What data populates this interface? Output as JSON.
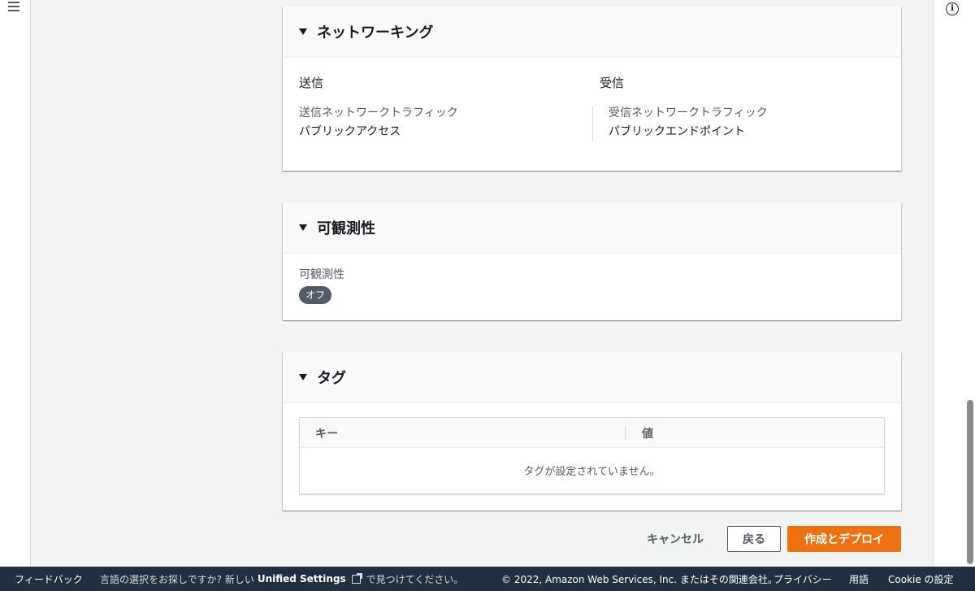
{
  "networking": {
    "title": "ネットワーキング",
    "outbound": {
      "heading": "送信",
      "label": "送信ネットワークトラフィック",
      "value": "パブリックアクセス"
    },
    "inbound": {
      "heading": "受信",
      "label": "受信ネットワークトラフィック",
      "value": "パブリックエンドポイント"
    }
  },
  "observability": {
    "title": "可観測性",
    "label": "可観測性",
    "status": "オフ"
  },
  "tags": {
    "title": "タグ",
    "columns": [
      "キー",
      "値"
    ],
    "empty_message": "タグが設定されていません。"
  },
  "actions": {
    "cancel": "キャンセル",
    "back": "戻る",
    "create": "作成とデプロイ"
  },
  "footer": {
    "feedback": "フィードバック",
    "lang_prefix": "言語の選択をお探しですか? 新しい",
    "unified_settings": "Unified Settings",
    "lang_suffix": "で見つけてください。",
    "copyright": "© 2022, Amazon Web Services, Inc. またはその関連会社。",
    "privacy": "プライバシー",
    "terms": "用語",
    "cookie": "Cookie の設定"
  },
  "colors": {
    "primary": "#ec7211",
    "footer_bg": "#232f3e",
    "badge_bg": "#545b64"
  },
  "icons": [
    "menu-icon",
    "info-icon",
    "caret-down-icon",
    "external-link-icon"
  ]
}
